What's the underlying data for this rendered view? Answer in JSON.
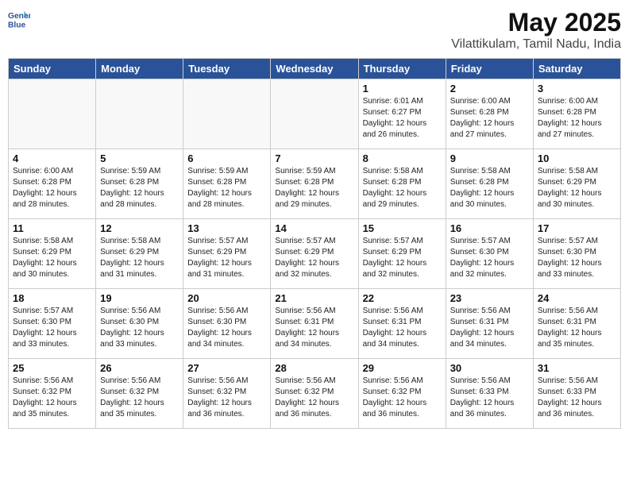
{
  "header": {
    "logo_line1": "General",
    "logo_line2": "Blue",
    "month_year": "May 2025",
    "location": "Vilattikulam, Tamil Nadu, India"
  },
  "days_of_week": [
    "Sunday",
    "Monday",
    "Tuesday",
    "Wednesday",
    "Thursday",
    "Friday",
    "Saturday"
  ],
  "weeks": [
    [
      {
        "day": "",
        "info": ""
      },
      {
        "day": "",
        "info": ""
      },
      {
        "day": "",
        "info": ""
      },
      {
        "day": "",
        "info": ""
      },
      {
        "day": "1",
        "info": "Sunrise: 6:01 AM\nSunset: 6:27 PM\nDaylight: 12 hours\nand 26 minutes."
      },
      {
        "day": "2",
        "info": "Sunrise: 6:00 AM\nSunset: 6:28 PM\nDaylight: 12 hours\nand 27 minutes."
      },
      {
        "day": "3",
        "info": "Sunrise: 6:00 AM\nSunset: 6:28 PM\nDaylight: 12 hours\nand 27 minutes."
      }
    ],
    [
      {
        "day": "4",
        "info": "Sunrise: 6:00 AM\nSunset: 6:28 PM\nDaylight: 12 hours\nand 28 minutes."
      },
      {
        "day": "5",
        "info": "Sunrise: 5:59 AM\nSunset: 6:28 PM\nDaylight: 12 hours\nand 28 minutes."
      },
      {
        "day": "6",
        "info": "Sunrise: 5:59 AM\nSunset: 6:28 PM\nDaylight: 12 hours\nand 28 minutes."
      },
      {
        "day": "7",
        "info": "Sunrise: 5:59 AM\nSunset: 6:28 PM\nDaylight: 12 hours\nand 29 minutes."
      },
      {
        "day": "8",
        "info": "Sunrise: 5:58 AM\nSunset: 6:28 PM\nDaylight: 12 hours\nand 29 minutes."
      },
      {
        "day": "9",
        "info": "Sunrise: 5:58 AM\nSunset: 6:28 PM\nDaylight: 12 hours\nand 30 minutes."
      },
      {
        "day": "10",
        "info": "Sunrise: 5:58 AM\nSunset: 6:29 PM\nDaylight: 12 hours\nand 30 minutes."
      }
    ],
    [
      {
        "day": "11",
        "info": "Sunrise: 5:58 AM\nSunset: 6:29 PM\nDaylight: 12 hours\nand 30 minutes."
      },
      {
        "day": "12",
        "info": "Sunrise: 5:58 AM\nSunset: 6:29 PM\nDaylight: 12 hours\nand 31 minutes."
      },
      {
        "day": "13",
        "info": "Sunrise: 5:57 AM\nSunset: 6:29 PM\nDaylight: 12 hours\nand 31 minutes."
      },
      {
        "day": "14",
        "info": "Sunrise: 5:57 AM\nSunset: 6:29 PM\nDaylight: 12 hours\nand 32 minutes."
      },
      {
        "day": "15",
        "info": "Sunrise: 5:57 AM\nSunset: 6:29 PM\nDaylight: 12 hours\nand 32 minutes."
      },
      {
        "day": "16",
        "info": "Sunrise: 5:57 AM\nSunset: 6:30 PM\nDaylight: 12 hours\nand 32 minutes."
      },
      {
        "day": "17",
        "info": "Sunrise: 5:57 AM\nSunset: 6:30 PM\nDaylight: 12 hours\nand 33 minutes."
      }
    ],
    [
      {
        "day": "18",
        "info": "Sunrise: 5:57 AM\nSunset: 6:30 PM\nDaylight: 12 hours\nand 33 minutes."
      },
      {
        "day": "19",
        "info": "Sunrise: 5:56 AM\nSunset: 6:30 PM\nDaylight: 12 hours\nand 33 minutes."
      },
      {
        "day": "20",
        "info": "Sunrise: 5:56 AM\nSunset: 6:30 PM\nDaylight: 12 hours\nand 34 minutes."
      },
      {
        "day": "21",
        "info": "Sunrise: 5:56 AM\nSunset: 6:31 PM\nDaylight: 12 hours\nand 34 minutes."
      },
      {
        "day": "22",
        "info": "Sunrise: 5:56 AM\nSunset: 6:31 PM\nDaylight: 12 hours\nand 34 minutes."
      },
      {
        "day": "23",
        "info": "Sunrise: 5:56 AM\nSunset: 6:31 PM\nDaylight: 12 hours\nand 34 minutes."
      },
      {
        "day": "24",
        "info": "Sunrise: 5:56 AM\nSunset: 6:31 PM\nDaylight: 12 hours\nand 35 minutes."
      }
    ],
    [
      {
        "day": "25",
        "info": "Sunrise: 5:56 AM\nSunset: 6:32 PM\nDaylight: 12 hours\nand 35 minutes."
      },
      {
        "day": "26",
        "info": "Sunrise: 5:56 AM\nSunset: 6:32 PM\nDaylight: 12 hours\nand 35 minutes."
      },
      {
        "day": "27",
        "info": "Sunrise: 5:56 AM\nSunset: 6:32 PM\nDaylight: 12 hours\nand 36 minutes."
      },
      {
        "day": "28",
        "info": "Sunrise: 5:56 AM\nSunset: 6:32 PM\nDaylight: 12 hours\nand 36 minutes."
      },
      {
        "day": "29",
        "info": "Sunrise: 5:56 AM\nSunset: 6:32 PM\nDaylight: 12 hours\nand 36 minutes."
      },
      {
        "day": "30",
        "info": "Sunrise: 5:56 AM\nSunset: 6:33 PM\nDaylight: 12 hours\nand 36 minutes."
      },
      {
        "day": "31",
        "info": "Sunrise: 5:56 AM\nSunset: 6:33 PM\nDaylight: 12 hours\nand 36 minutes."
      }
    ]
  ]
}
